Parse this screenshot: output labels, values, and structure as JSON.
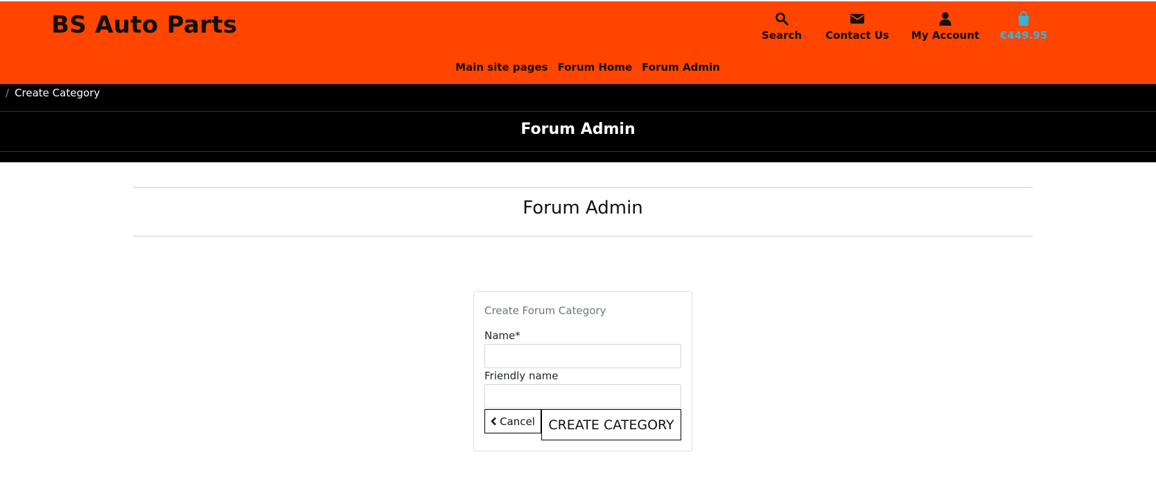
{
  "header": {
    "site_title": "BS Auto Parts",
    "utility": {
      "search_label": "Search",
      "contact_label": "Contact Us",
      "account_label": "My Account",
      "cart_total": "€449.95"
    },
    "nav": [
      "Main site pages",
      "Forum Home",
      "Forum Admin"
    ],
    "colors": {
      "background": "#ff4500",
      "cart_accent": "#35b3dc"
    }
  },
  "breadcrumb": {
    "separator": "/",
    "current": "Create Category"
  },
  "banner": {
    "title": "Forum Admin"
  },
  "section": {
    "title": "Forum Admin"
  },
  "form": {
    "card_title": "Create Forum Category",
    "name_label": "Name*",
    "name_value": "",
    "friendly_label": "Friendly name",
    "friendly_value": "",
    "cancel_label": "Cancel",
    "submit_label": "CREATE CATEGORY"
  },
  "icons": {
    "search": "search-icon",
    "contact": "envelope-icon",
    "account": "user-icon",
    "cart": "shopping-bag-icon",
    "cancel": "chevron-left-icon"
  }
}
